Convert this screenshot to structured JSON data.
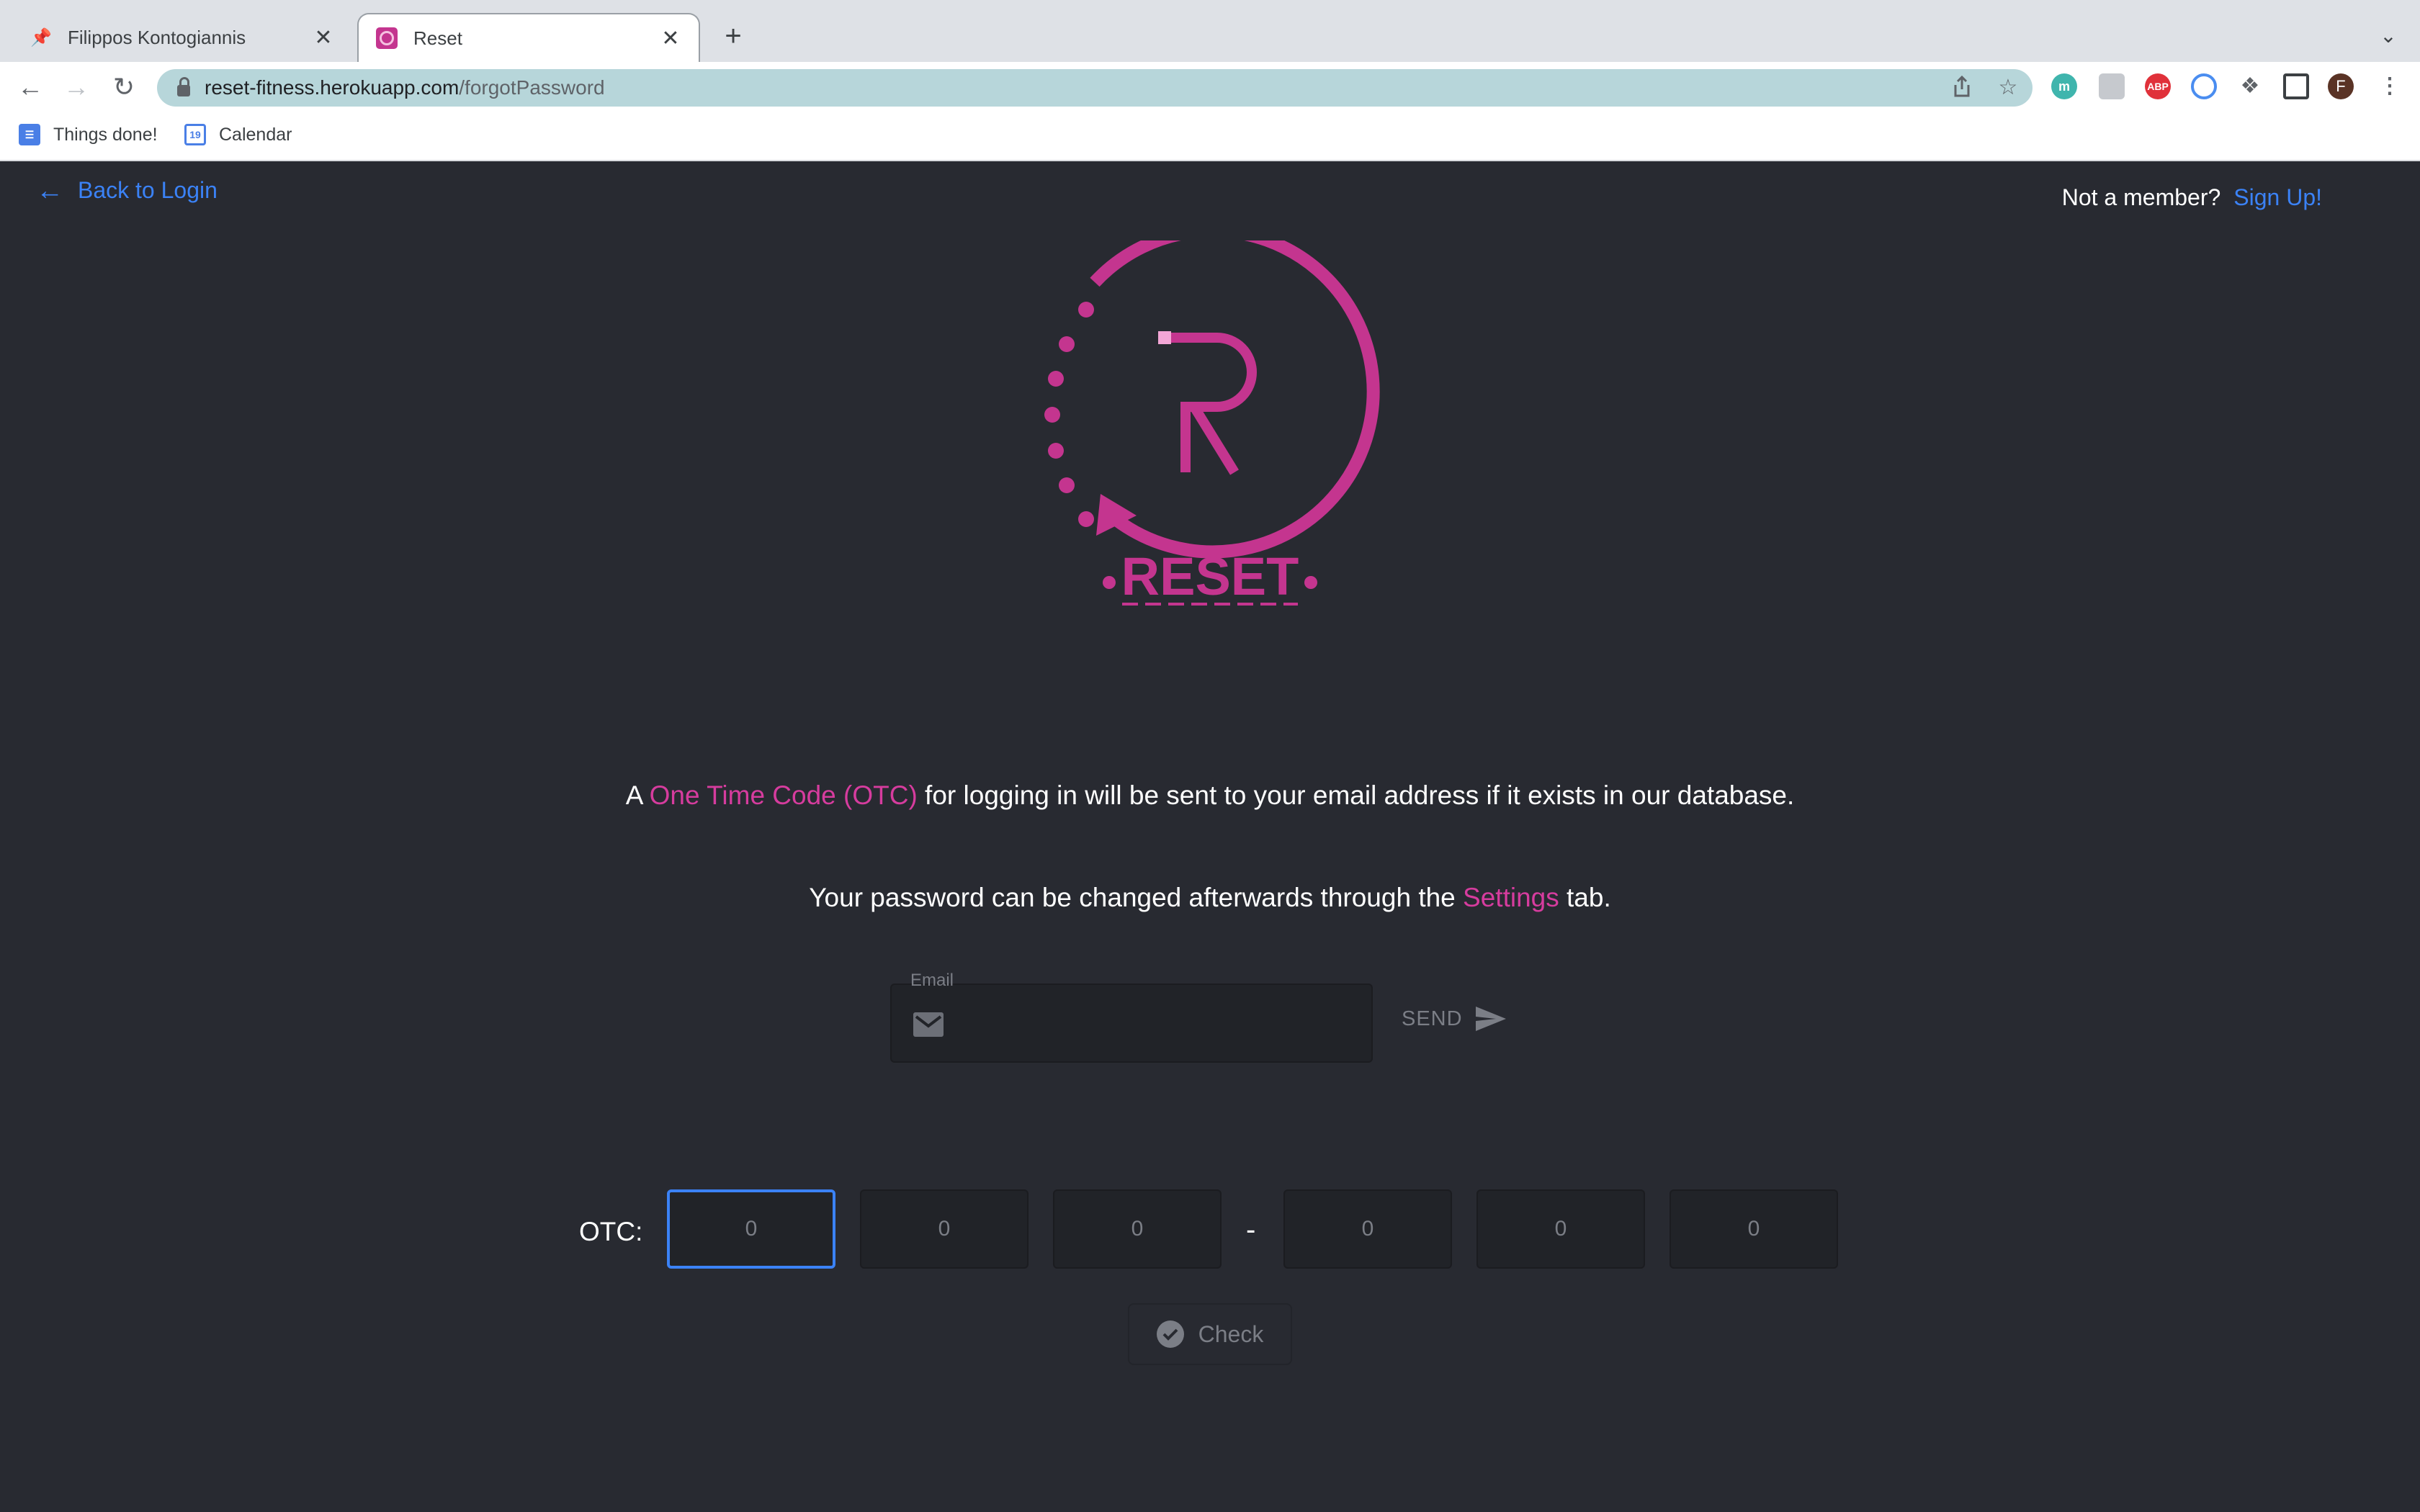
{
  "browser": {
    "tabs": [
      {
        "title": "Filippos Kontogiannis",
        "active": false
      },
      {
        "title": "Reset",
        "active": true
      }
    ],
    "url_host": "reset-fitness.herokuapp.com",
    "url_path": "/forgotPassword",
    "bookmarks": [
      {
        "label": "Things done!",
        "icon": "docs-icon"
      },
      {
        "label": "Calendar",
        "icon": "calendar-icon",
        "icon_text": "19"
      }
    ],
    "extensions": [
      {
        "name": "m-extension-icon",
        "text": "m",
        "color": "#3fb5ad"
      },
      {
        "name": "translate-extension-icon",
        "text": "",
        "color": "#9aa0a6"
      },
      {
        "name": "adblock-plus-icon",
        "text": "ABP",
        "color": "#e0313a"
      },
      {
        "name": "clock-extension-icon",
        "text": "",
        "color": "#4a8df0"
      },
      {
        "name": "puzzle-extensions-icon",
        "text": "",
        "color": "#5f6368"
      }
    ],
    "profile_initial": "F"
  },
  "header": {
    "back_label": "Back to Login",
    "member_question": "Not a member?",
    "signup_label": "Sign Up!"
  },
  "logo": {
    "brand": "RESET",
    "color": "#c4358f"
  },
  "info": {
    "line1_pre": "A ",
    "line1_highlight": "One Time Code (OTC)",
    "line1_post": " for logging in will be sent to your email address if it exists in our database.",
    "line2_pre": "Your password can be changed afterwards through the ",
    "line2_highlight": "Settings",
    "line2_post": " tab."
  },
  "email": {
    "label": "Email",
    "value": "",
    "send_label": "SEND"
  },
  "otc": {
    "label": "OTC:",
    "separator": "-",
    "digits": [
      "0",
      "0",
      "0",
      "0",
      "0",
      "0"
    ],
    "check_label": "Check"
  },
  "colors": {
    "accent": "#d63c9e",
    "link": "#3b82f6",
    "background": "#282a31"
  }
}
